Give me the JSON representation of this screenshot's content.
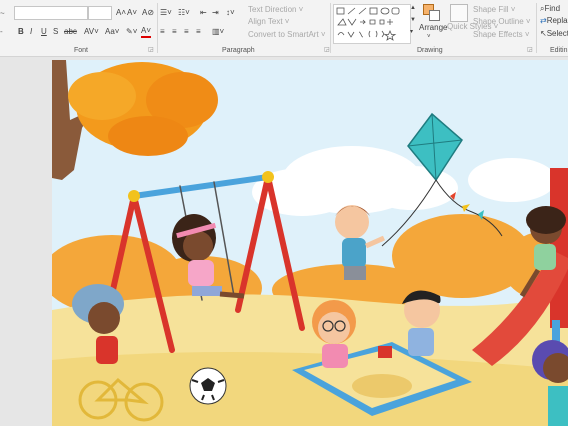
{
  "ribbon": {
    "font_group": {
      "label": "Font",
      "grow_label": "A˄",
      "shrink_label": "A˅",
      "clear_format_label": "A⊘",
      "bold": "B",
      "italic": "I",
      "underline": "U",
      "shadow": "S",
      "strikethrough": "abc",
      "spacing": "AV˅",
      "case": "Aa˅",
      "font_color": "A˅",
      "font_name_value": "",
      "font_size_value": ""
    },
    "paragraph_group": {
      "label": "Paragraph",
      "text_direction": "Text Direction ˅",
      "align_text": "Align Text ˅",
      "convert_smartart": "Convert to SmartArt ˅"
    },
    "drawing_group": {
      "label": "Drawing",
      "arrange": "Arrange",
      "quick_styles": "Quick Styles ˅",
      "shape_fill": "Shape Fill ˅",
      "shape_outline": "Shape Outline ˅",
      "shape_effects": "Shape Effects ˅"
    },
    "editing_group": {
      "label": "Editin",
      "find": "Find",
      "replace": "Replac",
      "select": "Select"
    }
  },
  "colors": {
    "ribbon_bg": "#f3f3f3",
    "workspace_bg": "#e6e6e6",
    "sky": "#dff1fa",
    "ground": "#f6e29a",
    "tree_orange": "#f39a1c"
  },
  "slide": {
    "subject": "playground-illustration"
  }
}
